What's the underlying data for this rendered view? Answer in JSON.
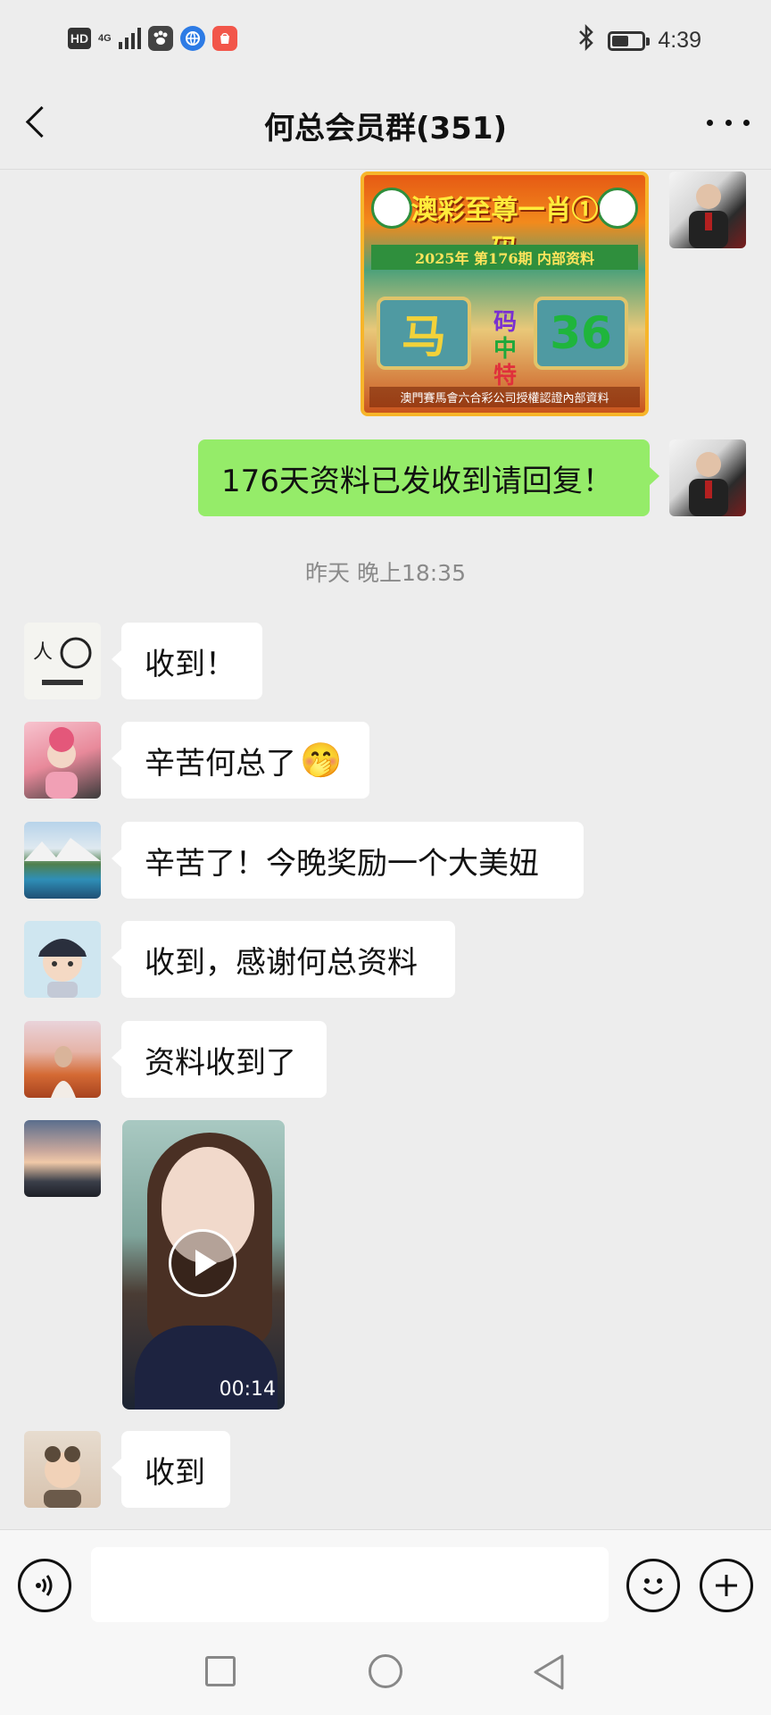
{
  "status_bar": {
    "hd_label": "HD",
    "network_label": "4G",
    "time": "4:39",
    "bluetooth_icon": "bluetooth-icon",
    "battery_level": 0.55,
    "apps": [
      "paw-app-icon",
      "browser-app-icon",
      "shop-app-icon"
    ]
  },
  "header": {
    "title": "何总会员群(351)",
    "back_icon": "chevron-left-icon",
    "more_icon": "more-dots-icon"
  },
  "messages": {
    "image_card": {
      "title": "澳彩至尊一肖①码",
      "band": "2025年 第176期 内部资料",
      "left_panel": "马",
      "middle_chars": [
        "码",
        "中",
        "特"
      ],
      "right_panel": "36",
      "footer": "澳門賽馬會六合彩公司授權認證內部資料"
    },
    "outgoing_text": "176天资料已发收到请回复！",
    "timestamp": "昨天 晚上18:35",
    "incoming": [
      {
        "text": "收到！"
      },
      {
        "text": "辛苦何总了",
        "emoji": "🤭"
      },
      {
        "text": "辛苦了！今晚奖励一个大美妞"
      },
      {
        "text": "收到，感谢何总资料"
      },
      {
        "text": "资料收到了"
      },
      {
        "text": "收到"
      }
    ],
    "video": {
      "duration": "00:14",
      "play_icon": "play-icon"
    }
  },
  "input_bar": {
    "voice_icon": "voice-icon",
    "emoji_icon": "emoji-icon",
    "plus_icon": "plus-icon",
    "placeholder": ""
  },
  "colors": {
    "outgoing_bubble": "#95ec69",
    "incoming_bubble": "#ffffff",
    "background": "#ededed"
  }
}
